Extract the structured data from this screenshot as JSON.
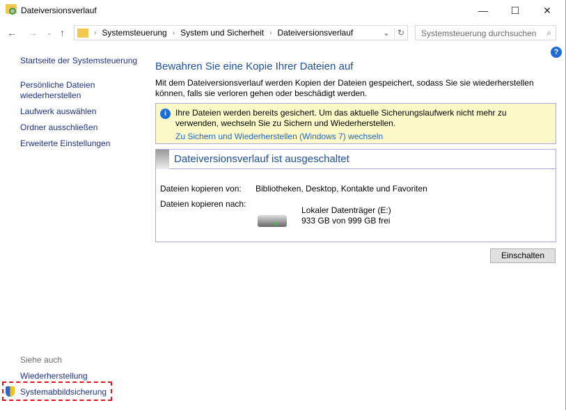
{
  "window": {
    "title": "Dateiversionsverlauf"
  },
  "address": {
    "crumbs": [
      "Systemsteuerung",
      "System und Sicherheit",
      "Dateiversionsverlauf"
    ],
    "search_placeholder": "Systemsteuerung durchsuchen"
  },
  "sidebar": {
    "items": [
      "Startseite der Systemsteuerung",
      "Persönliche Dateien wiederherstellen",
      "Laufwerk auswählen",
      "Ordner ausschließen",
      "Erweiterte Einstellungen"
    ],
    "see_also": "Siehe auch",
    "see_also_items": [
      "Wiederherstellung",
      "Systemabbildsicherung"
    ]
  },
  "main": {
    "heading": "Bewahren Sie eine Kopie Ihrer Dateien auf",
    "description": "Mit dem Dateiversionsverlauf werden Kopien der Dateien gespeichert, sodass Sie sie wiederherstellen können, falls sie verloren gehen oder beschädigt werden.",
    "info_text": "Ihre Dateien werden bereits gesichert. Um das aktuelle Sicherungslaufwerk nicht mehr zu verwenden, wechseln Sie zu Sichern und Wiederherstellen.",
    "info_link": "Zu Sichern und Wiederherstellen (Windows 7) wechseln",
    "status_title": "Dateiversionsverlauf ist ausgeschaltet",
    "copy_from_label": "Dateien kopieren von:",
    "copy_from_value": "Bibliotheken, Desktop, Kontakte und Favoriten",
    "copy_to_label": "Dateien kopieren nach:",
    "drive_name": "Lokaler Datenträger (E:)",
    "drive_space": "933 GB von 999 GB frei",
    "enable_button": "Einschalten"
  }
}
